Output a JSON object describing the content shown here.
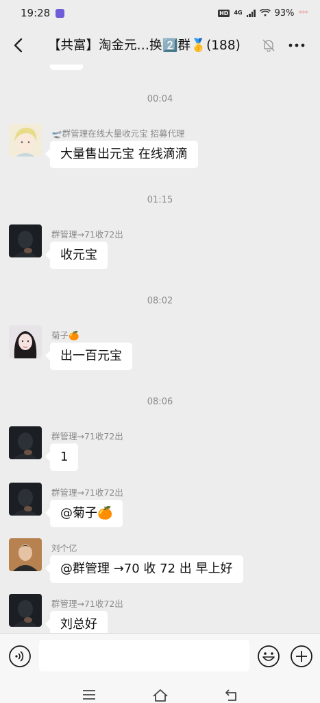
{
  "status": {
    "time": "19:28",
    "hd": "HD",
    "network": "4G",
    "battery": "93%",
    "battery_extra": "*** "
  },
  "header": {
    "title": "【共富】淘金元…换2️⃣群🥇(188)"
  },
  "chat": {
    "top_bubble": "",
    "messages": [
      {
        "kind": "time",
        "text": "00:04"
      },
      {
        "kind": "msg",
        "sender": "🛫群管理在线大量收元宝  招募代理",
        "text": "大量售出元宝 在线滴滴",
        "avatar": "cartoon-avatar"
      },
      {
        "kind": "time",
        "text": "01:15"
      },
      {
        "kind": "msg",
        "sender": "群管理→71收72出",
        "text": "收元宝",
        "avatar": "dark-avatar"
      },
      {
        "kind": "time",
        "text": "08:02"
      },
      {
        "kind": "msg",
        "sender": "菊子🍊",
        "text": "出一百元宝",
        "avatar": "woman-avatar"
      },
      {
        "kind": "time",
        "text": "08:06"
      },
      {
        "kind": "msg",
        "sender": "群管理→71收72出",
        "text": "1",
        "avatar": "dark-avatar"
      },
      {
        "kind": "msg",
        "sender": "群管理→71收72出",
        "text": "@菊子🍊",
        "avatar": "dark-avatar"
      },
      {
        "kind": "msg",
        "sender": "刘个亿",
        "text": "@群管理 →70 收 72 出   早上好",
        "avatar": "man-avatar"
      },
      {
        "kind": "msg",
        "sender": "群管理→71收72出",
        "text": "刘总好",
        "avatar": "dark-avatar"
      }
    ]
  },
  "input": {
    "placeholder": ""
  }
}
